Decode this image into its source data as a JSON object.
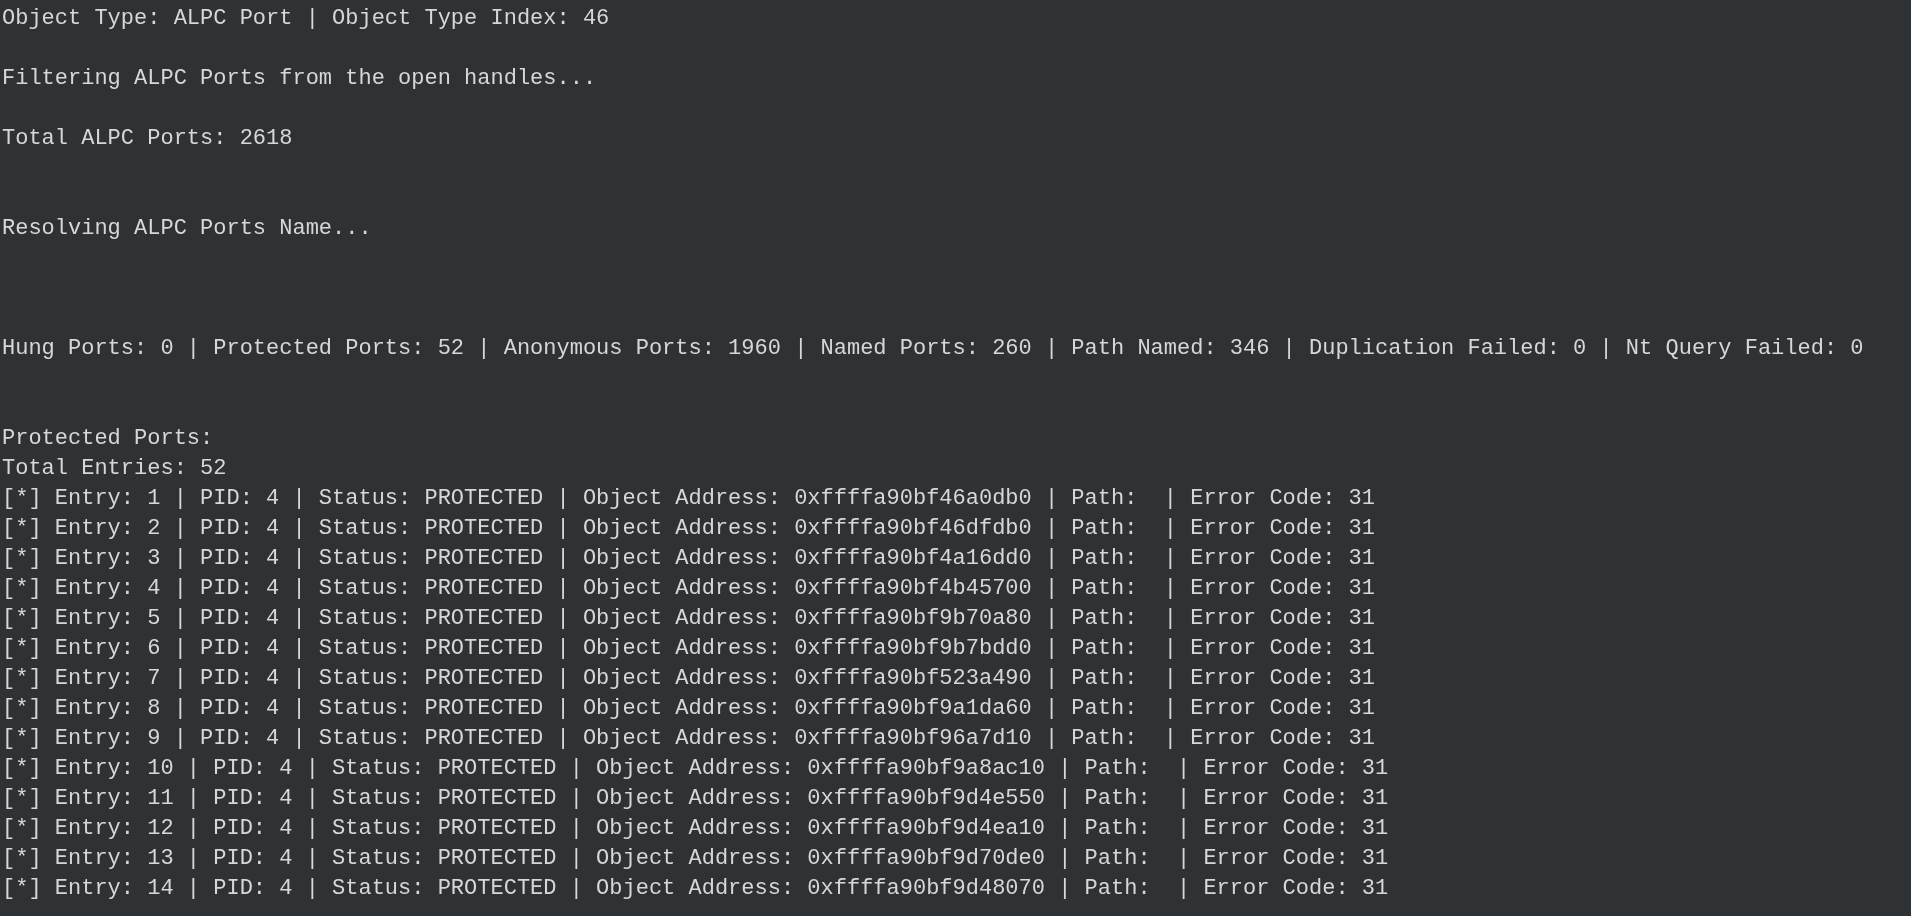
{
  "summary_lines": [
    "Object Type: ALPC Port | Object Type Index: 46",
    "Filtering ALPC Ports from the open handles...",
    "Total ALPC Ports: 2618",
    "Resolving ALPC Ports Name...",
    "Hung Ports: 0 | Protected Ports: 52 | Anonymous Ports: 1960 | Named Ports: 260 | Path Named: 346 | Duplication Failed: 0 | Nt Query Failed: 0"
  ],
  "section_title": "Protected Ports:",
  "total_entries": "Total Entries: 52",
  "entries": [
    "[*] Entry: 1 | PID: 4 | Status: PROTECTED | Object Address: 0xffffa90bf46a0db0 | Path:  | Error Code: 31",
    "[*] Entry: 2 | PID: 4 | Status: PROTECTED | Object Address: 0xffffa90bf46dfdb0 | Path:  | Error Code: 31",
    "[*] Entry: 3 | PID: 4 | Status: PROTECTED | Object Address: 0xffffa90bf4a16dd0 | Path:  | Error Code: 31",
    "[*] Entry: 4 | PID: 4 | Status: PROTECTED | Object Address: 0xffffa90bf4b45700 | Path:  | Error Code: 31",
    "[*] Entry: 5 | PID: 4 | Status: PROTECTED | Object Address: 0xffffa90bf9b70a80 | Path:  | Error Code: 31",
    "[*] Entry: 6 | PID: 4 | Status: PROTECTED | Object Address: 0xffffa90bf9b7bdd0 | Path:  | Error Code: 31",
    "[*] Entry: 7 | PID: 4 | Status: PROTECTED | Object Address: 0xffffa90bf523a490 | Path:  | Error Code: 31",
    "[*] Entry: 8 | PID: 4 | Status: PROTECTED | Object Address: 0xffffa90bf9a1da60 | Path:  | Error Code: 31",
    "[*] Entry: 9 | PID: 4 | Status: PROTECTED | Object Address: 0xffffa90bf96a7d10 | Path:  | Error Code: 31",
    "[*] Entry: 10 | PID: 4 | Status: PROTECTED | Object Address: 0xffffa90bf9a8ac10 | Path:  | Error Code: 31",
    "[*] Entry: 11 | PID: 4 | Status: PROTECTED | Object Address: 0xffffa90bf9d4e550 | Path:  | Error Code: 31",
    "[*] Entry: 12 | PID: 4 | Status: PROTECTED | Object Address: 0xffffa90bf9d4ea10 | Path:  | Error Code: 31",
    "[*] Entry: 13 | PID: 4 | Status: PROTECTED | Object Address: 0xffffa90bf9d70de0 | Path:  | Error Code: 31",
    "[*] Entry: 14 | PID: 4 | Status: PROTECTED | Object Address: 0xffffa90bf9d48070 | Path:  | Error Code: 31"
  ]
}
